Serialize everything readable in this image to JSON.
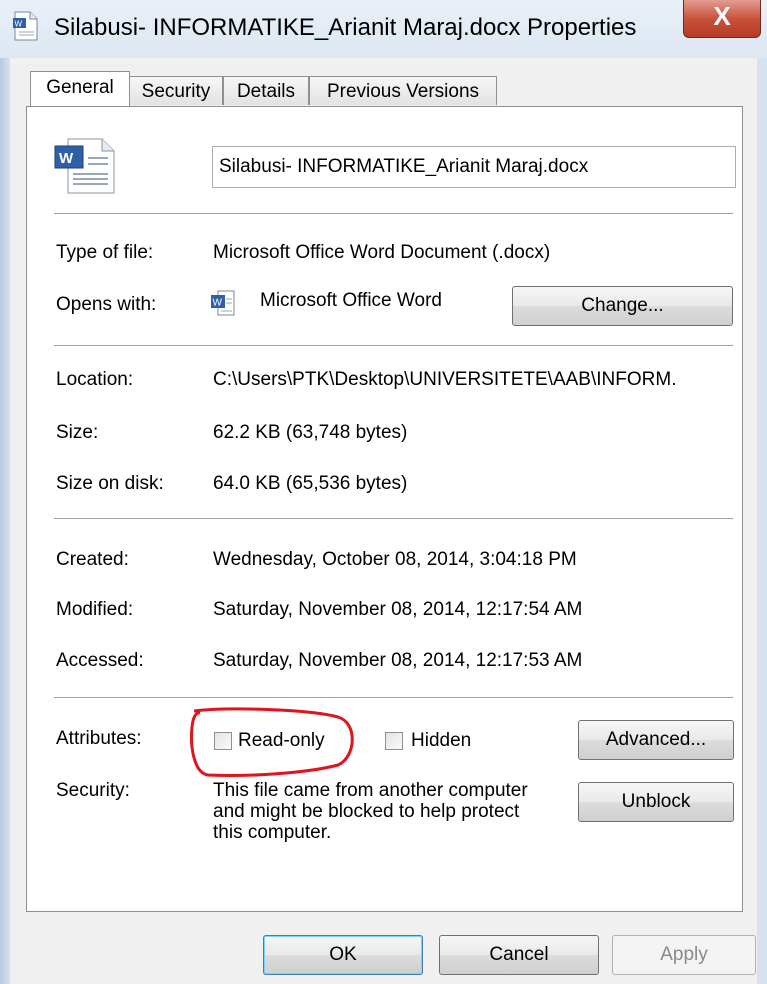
{
  "window": {
    "title": "Silabusi- INFORMATIKE_Arianit Maraj.docx Properties",
    "close_label": "X"
  },
  "tabs": [
    {
      "label": "General",
      "active": true
    },
    {
      "label": "Security"
    },
    {
      "label": "Details"
    },
    {
      "label": "Previous Versions"
    }
  ],
  "general": {
    "filename": "Silabusi- INFORMATIKE_Arianit Maraj.docx",
    "type_label": "Type of file:",
    "type_value": "Microsoft Office Word Document (.docx)",
    "opens_label": "Opens with:",
    "opens_value": "Microsoft Office Word",
    "change_label": "Change...",
    "location_label": "Location:",
    "location_value": "C:\\Users\\PTK\\Desktop\\UNIVERSITETE\\AAB\\INFORM.",
    "size_label": "Size:",
    "size_value": "62.2 KB (63,748 bytes)",
    "size_on_disk_label": "Size on disk:",
    "size_on_disk_value": "64.0 KB (65,536 bytes)",
    "created_label": "Created:",
    "created_value": "Wednesday, October 08, 2014, 3:04:18 PM",
    "modified_label": "Modified:",
    "modified_value": "Saturday, November 08, 2014, 12:17:54 AM",
    "accessed_label": "Accessed:",
    "accessed_value": "Saturday, November 08, 2014, 12:17:53 AM",
    "attributes_label": "Attributes:",
    "readonly_label": "Read-only",
    "readonly_checked": false,
    "hidden_label": "Hidden",
    "hidden_checked": false,
    "advanced_label": "Advanced...",
    "security_label": "Security:",
    "security_text_1": "This file came from another computer",
    "security_text_2": "and might be blocked to help protect",
    "security_text_3": "this computer.",
    "unblock_label": "Unblock"
  },
  "footer": {
    "ok_label": "OK",
    "cancel_label": "Cancel",
    "apply_label": "Apply"
  },
  "colors": {
    "annotation": "#e0141c",
    "close_button": "#c8523c",
    "focus_border": "#3c7fb1"
  },
  "icons": {
    "title": "word-document-icon",
    "file": "word-document-icon",
    "app": "word-app-icon"
  }
}
